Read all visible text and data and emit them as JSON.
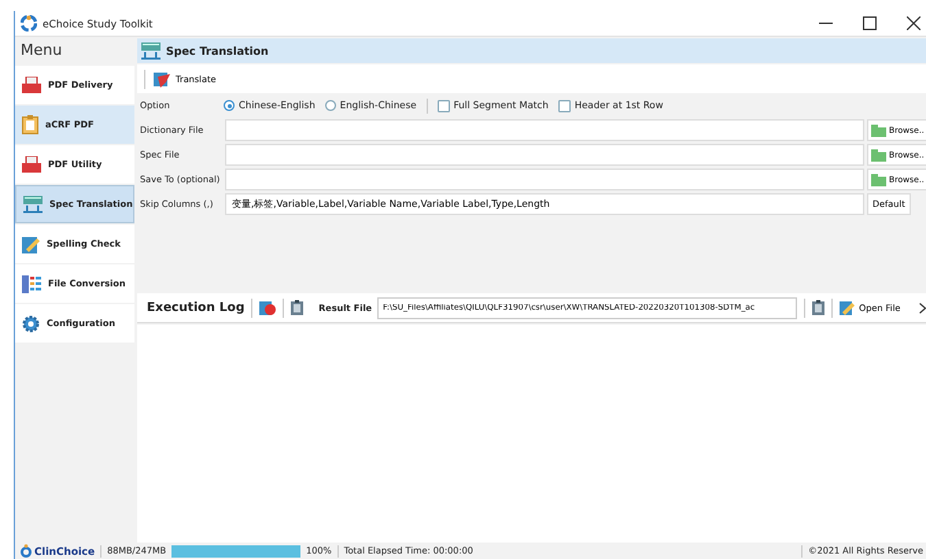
{
  "window": {
    "title": "eChoice Study Toolkit"
  },
  "sidebar": {
    "title": "Menu",
    "items": [
      {
        "label": "PDF Delivery",
        "kind": "pdf",
        "selected": false,
        "hovered": false
      },
      {
        "label": "aCRF PDF",
        "kind": "clipboard",
        "selected": false,
        "hovered": true
      },
      {
        "label": "PDF Utility",
        "kind": "pdf",
        "selected": false,
        "hovered": false
      },
      {
        "label": "Spec Translation",
        "kind": "table",
        "selected": true,
        "hovered": false
      },
      {
        "label": "Spelling Check",
        "kind": "pencil",
        "selected": false,
        "hovered": false
      },
      {
        "label": "File Conversion",
        "kind": "grid",
        "selected": false,
        "hovered": false
      },
      {
        "label": "Configuration",
        "kind": "gear",
        "selected": false,
        "hovered": false
      }
    ]
  },
  "panel": {
    "title": "Spec Translation",
    "toolbar": [
      "Translate"
    ],
    "option": {
      "label": "Option",
      "radios": [
        {
          "label": "Chinese-English",
          "selected": true
        },
        {
          "label": "English-Chinese",
          "selected": false
        }
      ],
      "checkboxes": [
        {
          "label": "Full Segment Match",
          "checked": false
        },
        {
          "label": "Header at 1st Row",
          "checked": false
        }
      ]
    },
    "fields": [
      {
        "label": "Dictionary File",
        "button": "Browse..",
        "kind": "browse"
      },
      {
        "label": "Spec File",
        "button": "Browse..",
        "kind": "browse"
      },
      {
        "label": "Save To (optional)",
        "button": "Browse..",
        "kind": "browse"
      },
      {
        "label": "Skip Columns (,)",
        "value": "变量,标签,Variable,Label,Variable Name,Variable Label,Type,Length",
        "button": "Default",
        "kind": "plain"
      }
    ]
  },
  "log": {
    "title": "Execution Log",
    "result_label": "Result File",
    "result_value": "F:\\SU_Files\\Affiliates\\QILU\\QLF31907\\csr\\user\\XW\\TRANSLATED-20220320T101308-SDTM_ac",
    "open_button": "Open File"
  },
  "status_bar": {
    "logo": "ClinChoice",
    "memory": "88MB/247MB",
    "progress": {
      "level": 1.0
    },
    "percent": "100%",
    "elapsed": "Total Elapsed Time: 00:00:00",
    "copyright": "©2021 All Rights Reserve"
  }
}
